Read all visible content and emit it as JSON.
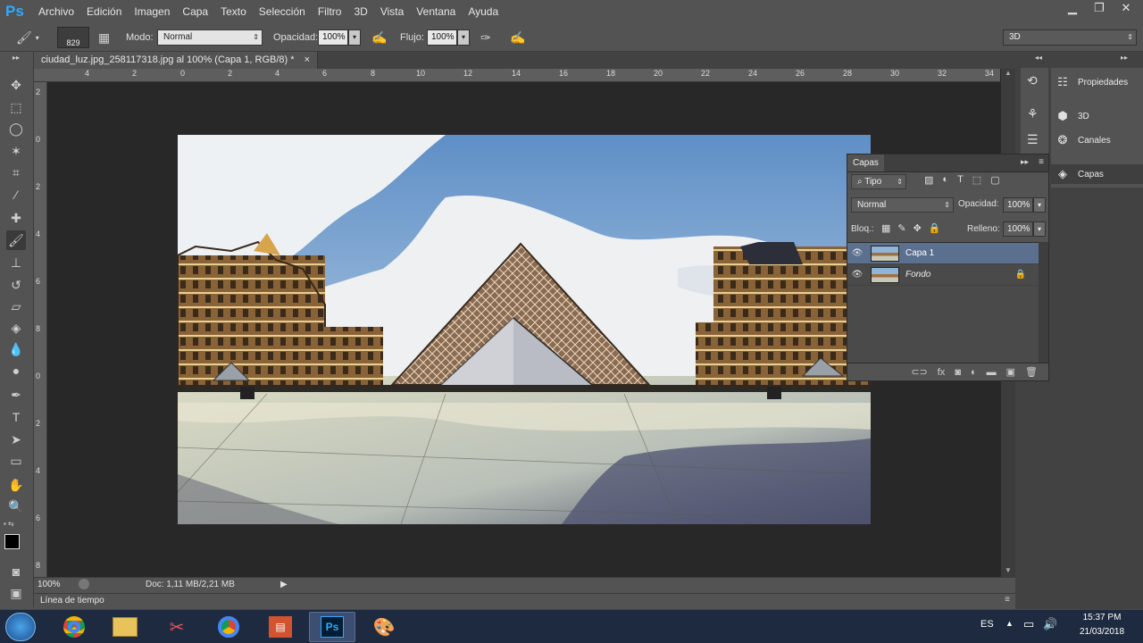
{
  "app": {
    "logo": "Ps"
  },
  "menu": [
    "Archivo",
    "Edición",
    "Imagen",
    "Capa",
    "Texto",
    "Selección",
    "Filtro",
    "3D",
    "Vista",
    "Ventana",
    "Ayuda"
  ],
  "window_controls": {
    "minimize": "▁",
    "restore": "❐",
    "close": "✕"
  },
  "options": {
    "brush_size": "829",
    "modo_label": "Modo:",
    "modo_value": "Normal",
    "opacidad_label": "Opacidad:",
    "opacidad_value": "100%",
    "flujo_label": "Flujo:",
    "flujo_value": "100%",
    "workspace": "3D"
  },
  "document": {
    "tab_title": "ciudad_luz.jpg_258117318.jpg al 100% (Capa 1, RGB/8) *",
    "tab_close": "×"
  },
  "ruler": {
    "top": [
      "4",
      "2",
      "0",
      "2",
      "4",
      "6",
      "8",
      "10",
      "12",
      "14",
      "16",
      "18",
      "20",
      "22",
      "24",
      "26",
      "28",
      "30",
      "32",
      "34"
    ],
    "left": [
      "2",
      "0",
      "2",
      "4",
      "6",
      "8",
      "0",
      "2",
      "4",
      "6",
      "8"
    ]
  },
  "status": {
    "zoom": "100%",
    "doc": "Doc: 1,11 MB/2,21 MB",
    "arrow": "▶"
  },
  "timeline": {
    "label": "Línea de tiempo"
  },
  "right_panels": [
    {
      "label": "Propiedades",
      "icon": "properties-icon"
    },
    {
      "label": "3D",
      "icon": "cube-icon"
    },
    {
      "label": "Canales",
      "icon": "channels-icon"
    },
    {
      "label": "Capas",
      "icon": "layers-icon"
    }
  ],
  "capas": {
    "title": "Capas",
    "filter": "Tipo",
    "blend": "Normal",
    "opacidad_label": "Opacidad:",
    "opacidad_value": "100%",
    "bloq_label": "Bloq.:",
    "relleno_label": "Relleno:",
    "relleno_value": "100%",
    "layers": [
      {
        "name": "Capa 1",
        "selected": true
      },
      {
        "name": "Fondo",
        "selected": false
      }
    ]
  },
  "taskbar": {
    "lang": "ES",
    "time": "15:37 PM",
    "date": "21/03/2018",
    "apps": [
      "Chrome",
      "Explorador",
      "Recortes",
      "Chrome",
      "PowerPoint",
      "Photoshop",
      "Paint"
    ]
  },
  "colors": {
    "accent": "#30a8ff",
    "panel": "#535353",
    "canvas": "#282828",
    "selected_layer": "#5b6f8f"
  }
}
